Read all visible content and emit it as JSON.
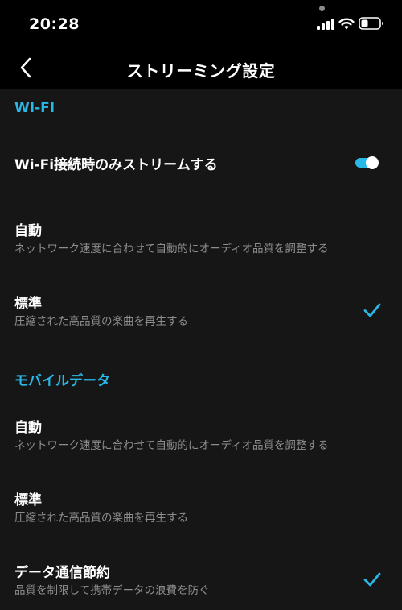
{
  "status_bar": {
    "time": "20:28"
  },
  "header": {
    "title": "ストリーミング設定"
  },
  "colors": {
    "accent": "#29b9e8",
    "background": "#161616",
    "bar": "#000000"
  },
  "wifi_section": {
    "header": "WI-FI",
    "stream_only_on_wifi": {
      "label": "Wi-Fi接続時のみストリームする",
      "enabled": true
    },
    "options": [
      {
        "title": "自動",
        "subtitle": "ネットワーク速度に合わせて自動的にオーディオ品質を調整する",
        "selected": false
      },
      {
        "title": "標準",
        "subtitle": "圧縮された高品質の楽曲を再生する",
        "selected": true
      }
    ]
  },
  "mobile_section": {
    "header": "モバイルデータ",
    "options": [
      {
        "title": "自動",
        "subtitle": "ネットワーク速度に合わせて自動的にオーディオ品質を調整する",
        "selected": false
      },
      {
        "title": "標準",
        "subtitle": "圧縮された高品質の楽曲を再生する",
        "selected": false
      },
      {
        "title": "データ通信節約",
        "subtitle": "品質を制限して携帯データの浪費を防ぐ",
        "selected": true
      }
    ]
  },
  "icons": {
    "back": "chevron-left-icon",
    "check": "check-icon",
    "signal": "cellular-signal-icon",
    "wifi": "wifi-icon",
    "battery": "battery-icon"
  }
}
